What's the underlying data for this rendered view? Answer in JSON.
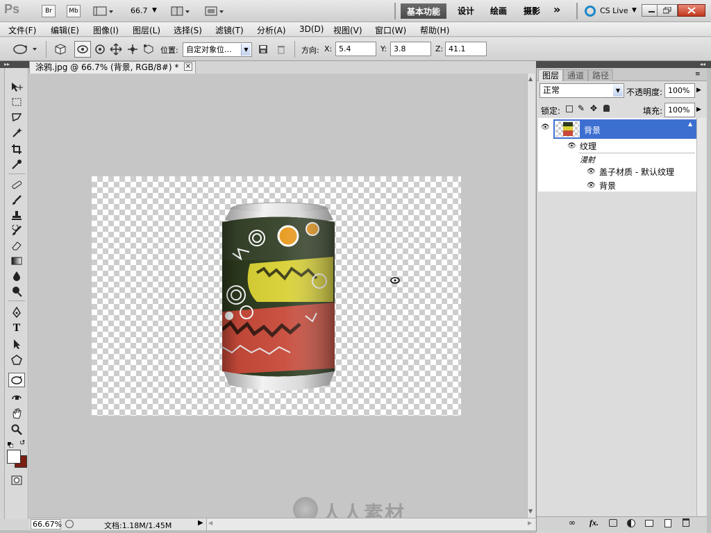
{
  "appbar": {
    "logo": "Ps",
    "br": "Br",
    "mb": "Mb",
    "zoom": "66.7",
    "workspaces": [
      "基本功能",
      "设计",
      "绘画",
      "摄影"
    ],
    "more": "»",
    "cs_live": "CS Live"
  },
  "menu": [
    "文件(F)",
    "编辑(E)",
    "图像(I)",
    "图层(L)",
    "选择(S)",
    "滤镜(T)",
    "分析(A)",
    "3D(D)",
    "视图(V)",
    "窗口(W)",
    "帮助(H)"
  ],
  "options": {
    "position_label": "位置:",
    "position_value": "自定对象位...",
    "direction_label": "方向:",
    "x_label": "X:",
    "x_value": "5.4",
    "y_label": "Y:",
    "y_value": "3.8",
    "z_label": "Z:",
    "z_value": "41.1"
  },
  "document": {
    "tab_title": "涂鸦.jpg @ 66.7% (背景, RGB/8#) *",
    "close": "×"
  },
  "status": {
    "zoom": "66.67%",
    "doc_info": "文档:1.18M/1.45M"
  },
  "watermark": "人人素材",
  "layers_panel": {
    "tabs": [
      "图层",
      "通道",
      "路径"
    ],
    "blend_mode": "正常",
    "opacity_label": "不透明度:",
    "opacity_value": "100%",
    "lock_label": "锁定:",
    "fill_label": "填充:",
    "fill_value": "100%",
    "layer_name": "背景",
    "sub1": "纹理",
    "sub2": "漫射",
    "sub3": "盖子材质 - 默认纹理",
    "sub4": "背景",
    "footer_fx": "fx."
  },
  "colors": {
    "accent": "#3f73c9",
    "selected_layer": "#3d6fd1",
    "foreground": "#ffffff",
    "background": "#7a1e14"
  }
}
